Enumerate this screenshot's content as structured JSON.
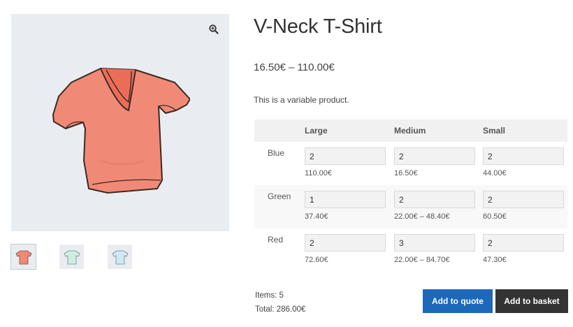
{
  "product": {
    "title": "V-Neck T-Shirt",
    "price_range": "16.50€ – 110.00€",
    "description": "This is a variable product."
  },
  "gallery": {
    "zoom_icon": "magnifier-plus-icon",
    "thumbnails": [
      {
        "name": "thumbnail-red-shirt",
        "color": "#f08a76"
      },
      {
        "name": "thumbnail-green-shirt",
        "color": "#cfeee1"
      },
      {
        "name": "thumbnail-blue-shirt",
        "color": "#cfe8f1"
      }
    ],
    "main_color": "#f08a76"
  },
  "grid": {
    "columns": [
      "Large",
      "Medium",
      "Small"
    ],
    "rows": [
      {
        "label": "Blue",
        "cells": [
          {
            "qty": "2",
            "price": "110.00€"
          },
          {
            "qty": "2",
            "price": "16.50€"
          },
          {
            "qty": "2",
            "price": "44.00€"
          }
        ]
      },
      {
        "label": "Green",
        "cells": [
          {
            "qty": "1",
            "price": "37.40€"
          },
          {
            "qty": "2",
            "price": "22.00€ – 48.40€"
          },
          {
            "qty": "2",
            "price": "60.50€"
          }
        ]
      },
      {
        "label": "Red",
        "cells": [
          {
            "qty": "2",
            "price": "72.60€"
          },
          {
            "qty": "3",
            "price": "22.00€ – 84.70€"
          },
          {
            "qty": "2",
            "price": "47.30€"
          }
        ]
      }
    ]
  },
  "summary": {
    "items": "Items: 5",
    "total": "Total: 286.00€"
  },
  "actions": {
    "quote_label": "Add to quote",
    "basket_label": "Add to basket",
    "quote_color": "#1d68b9",
    "basket_color": "#333333"
  }
}
